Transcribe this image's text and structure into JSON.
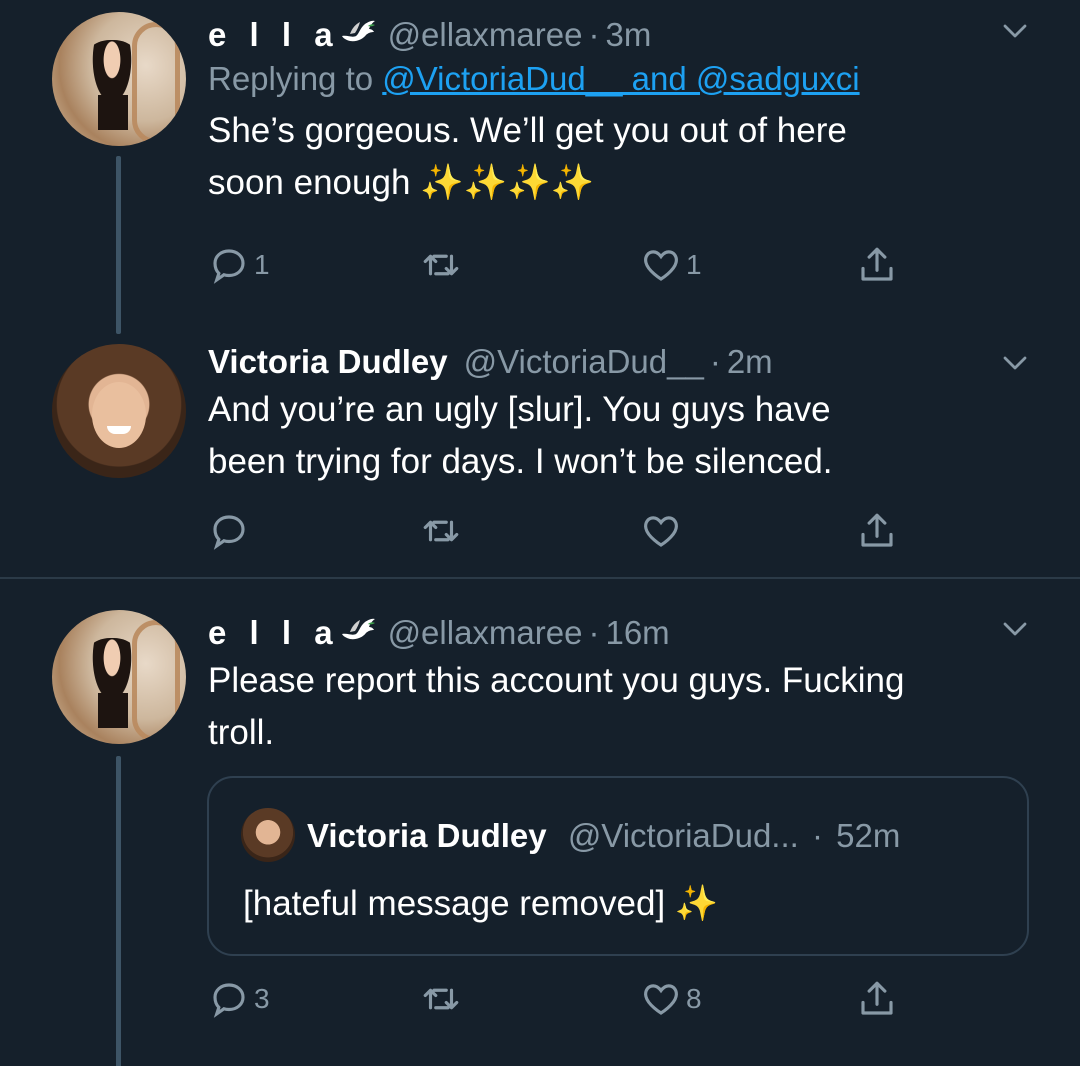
{
  "tweets": [
    {
      "name": "e l l a",
      "handle": "@ellaxmaree",
      "dot": "·",
      "time": "3m",
      "reply_prefix": "Replying to ",
      "reply_mentions": "@VictoriaDud__ and @sadguxci",
      "text_line1": "She’s gorgeous. We’ll get you out of here",
      "text_line2": "soon enough",
      "sparkles": "✨✨✨✨",
      "replies": "1",
      "retweets": "",
      "likes": "1"
    },
    {
      "name": "Victoria Dudley",
      "handle": "@VictoriaDud__",
      "dot": "·",
      "time": "2m",
      "text_line1": "And you’re an ugly [slur]. You guys have",
      "text_line2": "been trying for days. I won’t be silenced.",
      "replies": "",
      "retweets": "",
      "likes": ""
    },
    {
      "name": "e l l a",
      "handle": "@ellaxmaree",
      "dot": "·",
      "time": "16m",
      "text_line1": "Please report this account you guys. Fucking",
      "text_line2": "troll.",
      "replies": "3",
      "retweets": "",
      "likes": "8",
      "quote": {
        "name": "Victoria Dudley",
        "handle": "@VictoriaDud...",
        "dot": "·",
        "time": "52m",
        "text": "[hateful message removed]",
        "sparkle": "✨"
      }
    }
  ],
  "colors": {
    "background": "#15202b",
    "secondary": "#8899a6",
    "link": "#1da1f2",
    "line": "#3d5466"
  },
  "icons": [
    "dove-emoji-icon",
    "chevron-down-icon",
    "reply-icon",
    "retweet-icon",
    "like-icon",
    "share-icon"
  ]
}
